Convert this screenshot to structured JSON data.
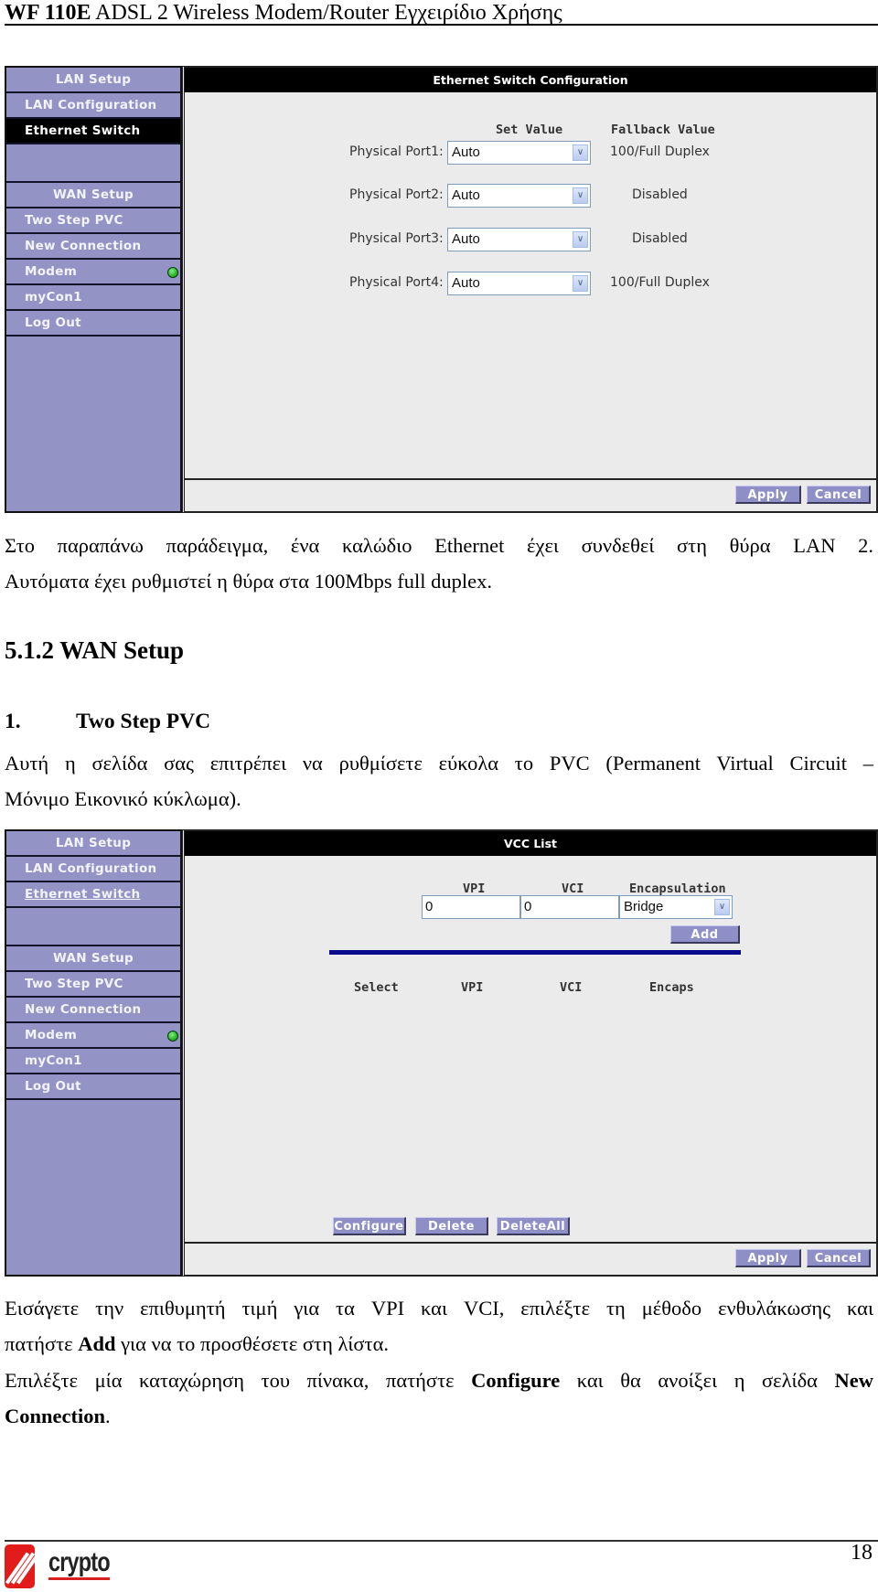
{
  "header": {
    "title_bold": "WF 110E",
    "title_rest": " ADSL 2 Wireless Modem/Router Εγχειρίδιο Χρήσης"
  },
  "sidebar": {
    "lan_header": "LAN Setup",
    "lan_configuration": "LAN Configuration",
    "ethernet_switch": "Ethernet Switch",
    "wan_header": "WAN Setup",
    "two_step_pvc": "Two Step PVC",
    "new_connection": "New Connection",
    "modem": "Modem",
    "mycon1": "myCon1",
    "log_out": "Log Out",
    "modem_status_color": "#22b022"
  },
  "screen1": {
    "title": "Ethernet Switch Configuration",
    "col_set_value": "Set Value",
    "col_fallback": "Fallback Value",
    "ports": [
      {
        "label": "Physical Port1:",
        "value": "Auto",
        "fallback": "100/Full Duplex"
      },
      {
        "label": "Physical Port2:",
        "value": "Auto",
        "fallback": "Disabled"
      },
      {
        "label": "Physical Port3:",
        "value": "Auto",
        "fallback": "Disabled"
      },
      {
        "label": "Physical Port4:",
        "value": "Auto",
        "fallback": "100/Full Duplex"
      }
    ],
    "apply": "Apply",
    "cancel": "Cancel"
  },
  "text1": {
    "line1": "Στο παραπάνω παράδειγμα, ένα καλώδιο Ethernet έχει συνδεθεί στη θύρα LAN 2.",
    "line2": "Αυτόματα έχει ρυθμιστεί η θύρα στα 100Mbps full duplex."
  },
  "section": {
    "heading": "5.1.2  WAN Setup",
    "sub_num": "1.",
    "sub_title": "Two Step PVC",
    "desc_line1": "Αυτή η σελίδα σας επιτρέπει να ρυθμίσετε εύκολα το PVC (Permanent Virtual Circuit –",
    "desc_line2": "Μόνιμο Εικονικό κύκλωμα)."
  },
  "screen2": {
    "title": "VCC List",
    "col_vpi": "VPI",
    "col_vci": "VCI",
    "col_encap": "Encapsulation",
    "vpi_value": "0",
    "vci_value": "0",
    "encap_value": "Bridge",
    "add": "Add",
    "list_select": "Select",
    "list_vpi": "VPI",
    "list_vci": "VCI",
    "list_encaps": "Encaps",
    "configure": "Configure",
    "delete": "Delete",
    "delete_all": "DeleteAll",
    "apply": "Apply",
    "cancel": "Cancel"
  },
  "text2": {
    "p1_line1": "Εισάγετε την επιθυμητή τιμή για τα VPI και VCI, επιλέξτε τη μέθοδο ενθυλάκωσης και",
    "p1_line2_a": "πατήστε ",
    "p1_line2_b": "Add",
    "p1_line2_c": " για να το προσθέσετε στη λίστα.",
    "p2_line1_a": "Επιλέξτε μία καταχώρηση του πίνακα, πατήστε ",
    "p2_line1_b": "Configure",
    "p2_line1_c": " και θα ανοίξει η σελίδα ",
    "p2_line1_d": "New",
    "p2_line2_a": "Connection",
    "p2_line2_b": "."
  },
  "footer": {
    "logo_text": "crypto",
    "page_number": "18"
  }
}
